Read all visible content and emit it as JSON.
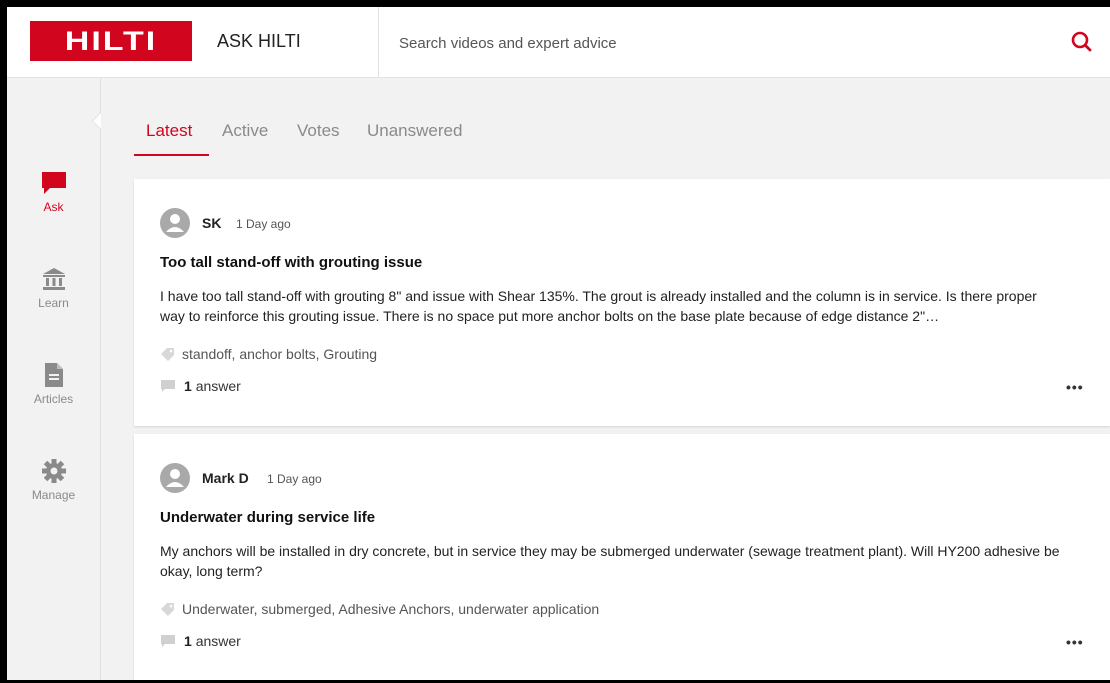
{
  "header": {
    "logo_text": "HILTI",
    "app_title": "ASK HILTI",
    "search_placeholder": "Search videos and expert advice",
    "search_icon": "search-icon"
  },
  "colors": {
    "brand": "#d2051e",
    "background": "#f2f2f2",
    "card": "#ffffff"
  },
  "sidebar": {
    "items": [
      {
        "label": "Ask",
        "icon": "chat-bubble-icon",
        "active": true
      },
      {
        "label": "Learn",
        "icon": "institution-icon",
        "active": false
      },
      {
        "label": "Articles",
        "icon": "document-icon",
        "active": false
      },
      {
        "label": "Manage",
        "icon": "gear-icon",
        "active": false
      }
    ]
  },
  "tabs": [
    {
      "label": "Latest",
      "active": true
    },
    {
      "label": "Active",
      "active": false
    },
    {
      "label": "Votes",
      "active": false
    },
    {
      "label": "Unanswered",
      "active": false
    }
  ],
  "posts": [
    {
      "author": "SK",
      "time": "1 Day ago",
      "title": "Too tall stand-off with grouting issue",
      "body": "I have too tall stand-off with grouting 8\" and issue with Shear 135%. The grout is already installed and the column is in service. Is there proper way to reinforce this grouting issue. There is no space put more anchor bolts on the base plate because of edge distance 2\"…",
      "tags": "standoff, anchor bolts, Grouting",
      "answer_count": "1",
      "answer_label": "answer",
      "more": "•••"
    },
    {
      "author": "Mark D",
      "time": "1 Day ago",
      "title": "Underwater during service life",
      "body": "My anchors will be installed in dry concrete, but in service they may be submerged underwater (sewage treatment plant). Will HY200 adhesive be okay, long term?",
      "tags": "Underwater, submerged, Adhesive Anchors, underwater application",
      "answer_count": "1",
      "answer_label": "answer",
      "more": "•••"
    }
  ]
}
